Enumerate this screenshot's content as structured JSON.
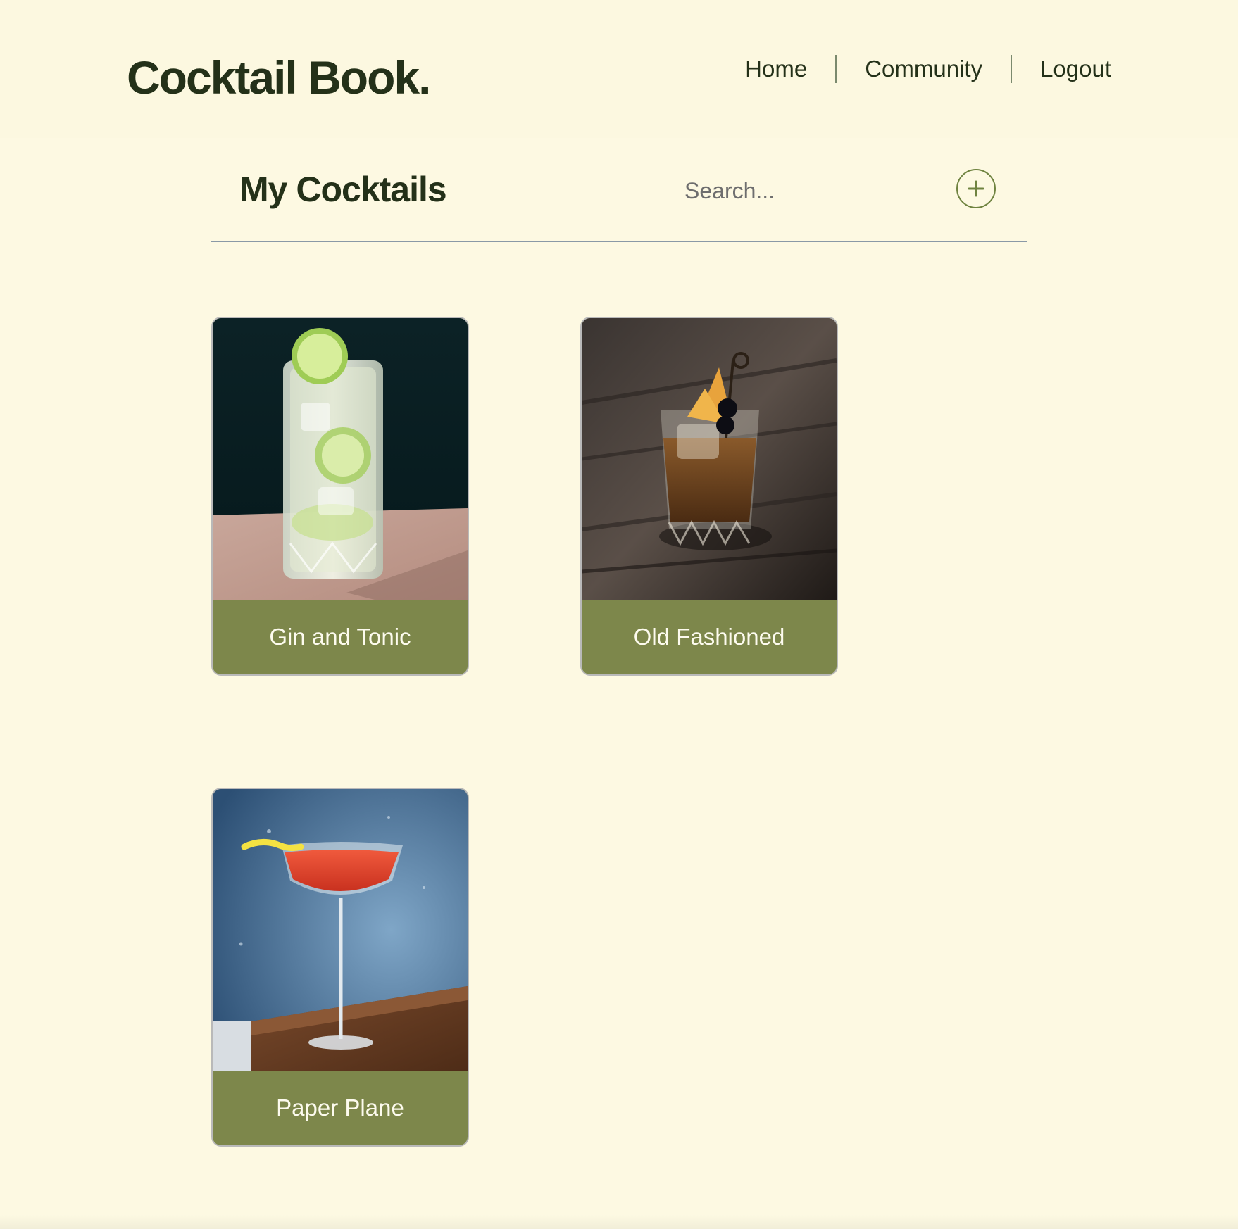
{
  "header": {
    "logo": "Cocktail Book.",
    "nav": [
      {
        "label": "Home"
      },
      {
        "label": "Community"
      },
      {
        "label": "Logout"
      }
    ]
  },
  "toolbar": {
    "title": "My Cocktails",
    "search_placeholder": "Search...",
    "add_icon": "plus-circle-icon"
  },
  "cocktails": [
    {
      "name": "Gin and Tonic"
    },
    {
      "name": "Old Fashioned"
    },
    {
      "name": "Paper Plane"
    }
  ],
  "colors": {
    "background": "#fdf9e2",
    "accent": "#7d874b",
    "text": "#243119"
  }
}
